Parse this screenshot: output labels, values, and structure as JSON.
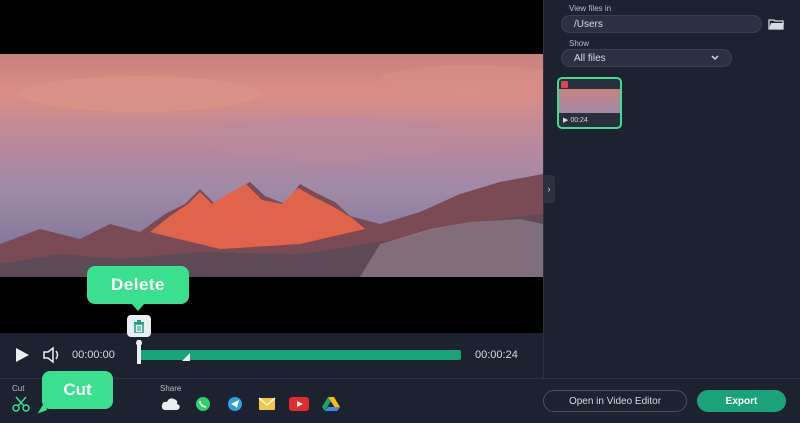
{
  "player": {
    "time_current": "00:00:00",
    "time_total": "00:00:24",
    "tooltip_delete": "Delete"
  },
  "toolbar": {
    "cut_label": "Cut",
    "cut_tooltip": "Cut",
    "share_label": "Share",
    "share_icons": [
      "cloud-icon",
      "whatsapp-icon",
      "telegram-icon",
      "mail-icon",
      "youtube-icon",
      "google-drive-icon"
    ],
    "open_in_editor_label": "Open in Video Editor",
    "export_label": "Export"
  },
  "panel": {
    "view_files_label": "View files in",
    "path_value": "/Users",
    "show_label": "Show",
    "show_value": "All files",
    "thumb_duration": "00:24"
  },
  "colors": {
    "accent": "#3be08f",
    "track": "#1aa37a",
    "background": "#1d2230"
  }
}
